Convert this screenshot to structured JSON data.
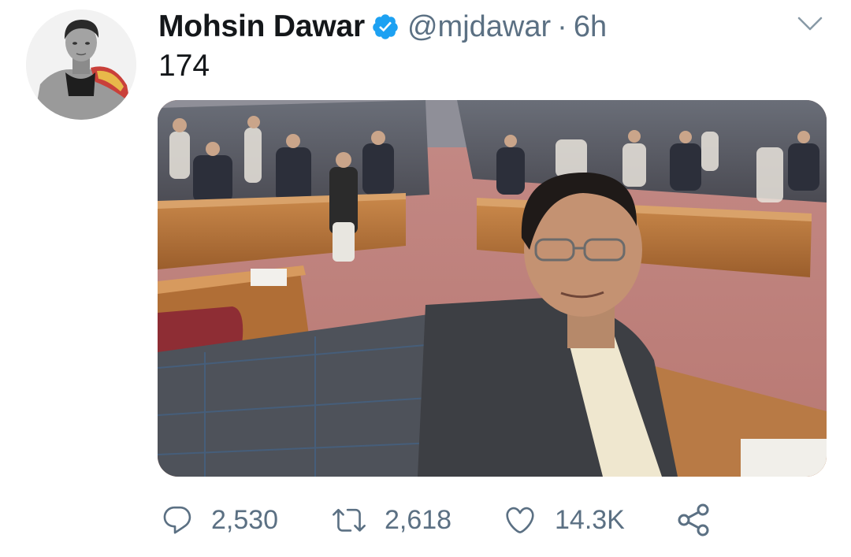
{
  "tweet": {
    "display_name": "Mohsin Dawar",
    "handle": "@mjdawar",
    "separator": "·",
    "time": "6h",
    "text": "174",
    "verified": true
  },
  "actions": {
    "reply": {
      "icon": "reply-icon",
      "count": "2,530"
    },
    "retweet": {
      "icon": "retweet-icon",
      "count": "2,618"
    },
    "like": {
      "icon": "heart-icon",
      "count": "14.3K"
    },
    "share": {
      "icon": "share-icon"
    }
  },
  "colors": {
    "verified_blue": "#1da1f2",
    "secondary_text": "#5b7083",
    "primary_text": "#14171a"
  }
}
